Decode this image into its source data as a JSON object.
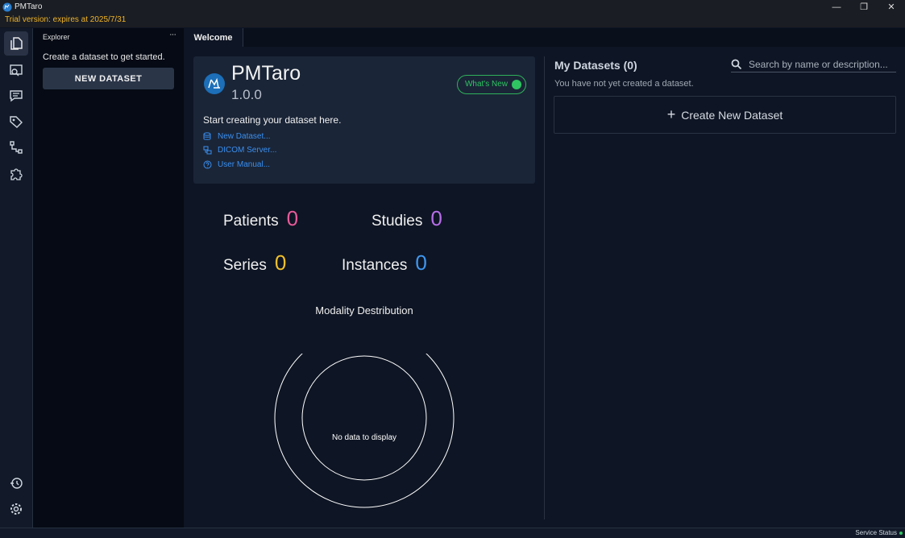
{
  "window": {
    "title": "PMTaro",
    "minimize": "—",
    "restore": "❐",
    "close": "✕"
  },
  "trial": "Trial version: expires at 2025/7/31",
  "activity_bar": {
    "items": [
      {
        "icon": "files-icon"
      },
      {
        "icon": "image-search-icon"
      },
      {
        "icon": "comments-icon"
      },
      {
        "icon": "tag-icon"
      },
      {
        "icon": "workflow-icon"
      },
      {
        "icon": "extensions-icon"
      }
    ],
    "bottom": [
      {
        "icon": "history-icon"
      },
      {
        "icon": "settings-icon"
      }
    ]
  },
  "explorer": {
    "header": "Explorer",
    "more": "···",
    "message": "Create a dataset to get started.",
    "new_button": "NEW DATASET"
  },
  "tabs": [
    {
      "label": "Welcome"
    }
  ],
  "welcome": {
    "app_name": "PMTaro",
    "version": "1.0.0",
    "whats_new": "What's New",
    "start_text": "Start creating your dataset here.",
    "links": {
      "new_dataset": "New Dataset...",
      "dicom_server": "DICOM Server...",
      "user_manual": "User Manual..."
    }
  },
  "stats": {
    "patients": {
      "label": "Patients",
      "value": "0",
      "color": "#e95a9a"
    },
    "studies": {
      "label": "Studies",
      "value": "0",
      "color": "#b76ee8"
    },
    "series": {
      "label": "Series",
      "value": "0",
      "color": "#f2c029"
    },
    "instances": {
      "label": "Instances",
      "value": "0",
      "color": "#3f97f0"
    }
  },
  "chart_data": {
    "type": "pie",
    "title": "Modality Destribution",
    "categories": [],
    "values": [],
    "empty_message": "No data to display"
  },
  "datasets": {
    "title": "My Datasets (0)",
    "search_placeholder": "Search by name or description...",
    "empty_message": "You have not yet created a dataset.",
    "create_button": "Create New Dataset",
    "create_icon": "+"
  },
  "status_bar": {
    "service": "Service Status"
  }
}
